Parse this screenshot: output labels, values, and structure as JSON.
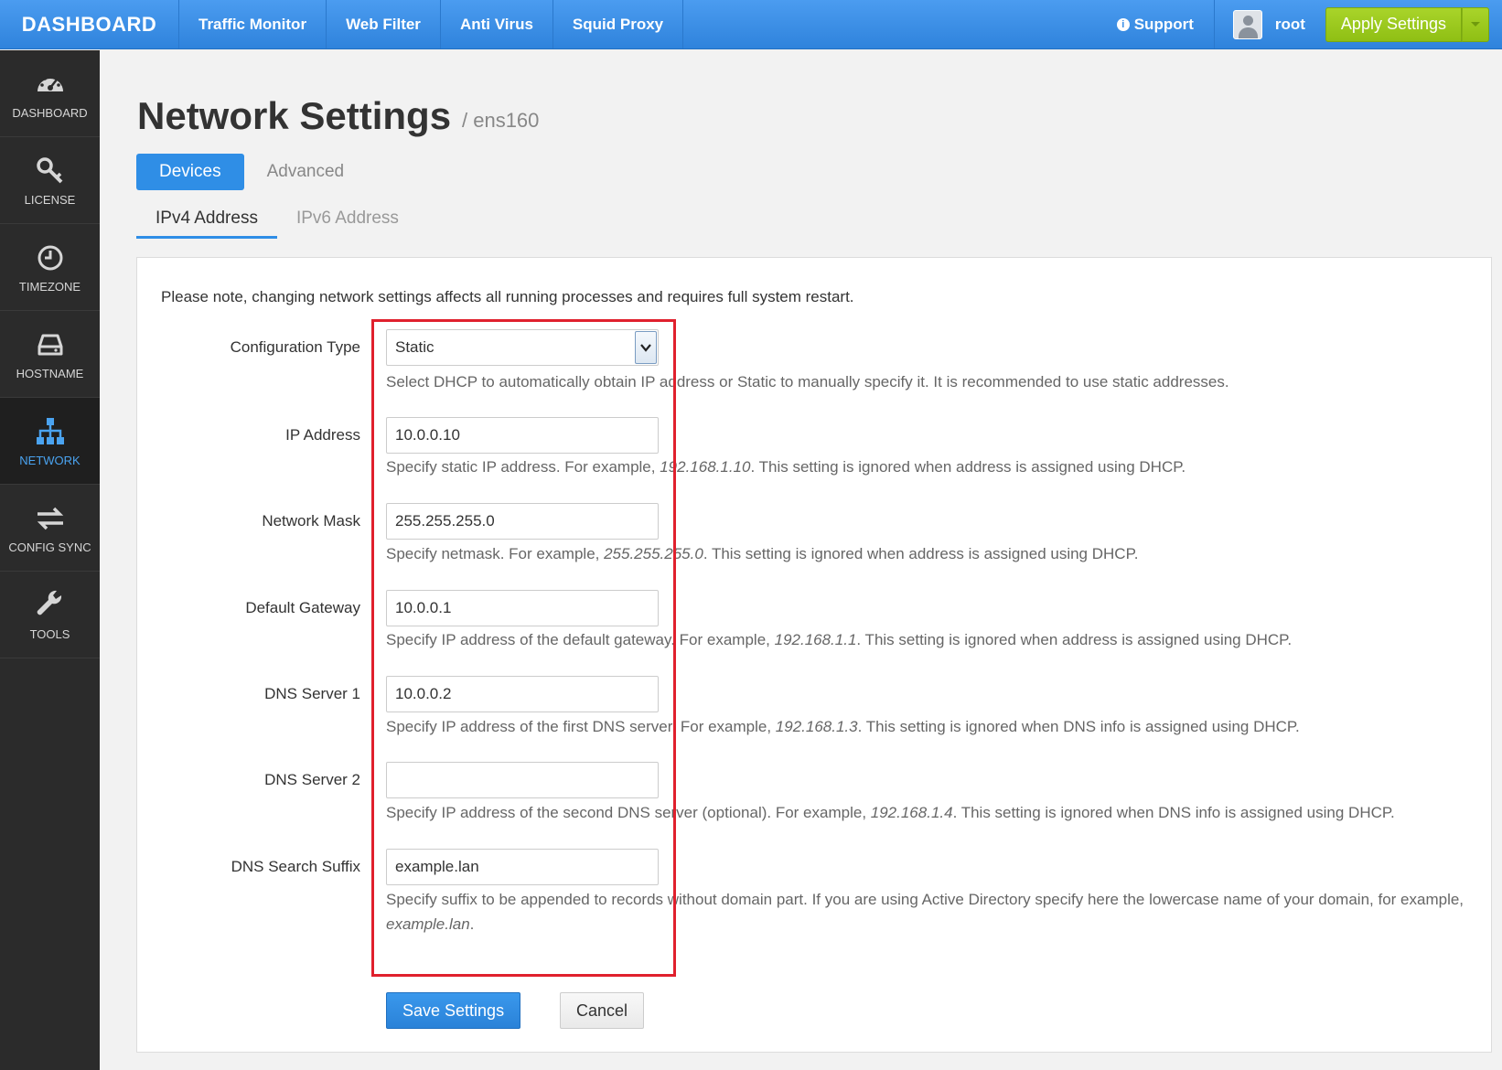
{
  "topbar": {
    "brand": "DASHBOARD",
    "nav": [
      "Traffic Monitor",
      "Web Filter",
      "Anti Virus",
      "Squid Proxy"
    ],
    "support": "Support",
    "user": "root",
    "apply": "Apply Settings"
  },
  "sidebar": {
    "items": [
      {
        "label": "DASHBOARD",
        "icon": "dashboard-icon"
      },
      {
        "label": "LICENSE",
        "icon": "key-icon"
      },
      {
        "label": "TIMEZONE",
        "icon": "clock-icon"
      },
      {
        "label": "HOSTNAME",
        "icon": "drive-icon"
      },
      {
        "label": "NETWORK",
        "icon": "network-icon"
      },
      {
        "label": "CONFIG SYNC",
        "icon": "sync-icon"
      },
      {
        "label": "TOOLS",
        "icon": "wrench-icon"
      }
    ],
    "active": "NETWORK"
  },
  "page": {
    "title": "Network Settings",
    "subtitle": "/ ens160",
    "tabs": [
      "Devices",
      "Advanced"
    ],
    "subtabs": [
      "IPv4 Address",
      "IPv6 Address"
    ],
    "note": "Please note, changing network settings affects all running processes and requires full system restart."
  },
  "form": {
    "config_type": {
      "label": "Configuration Type",
      "value": "Static",
      "help": "Select DHCP to automatically obtain IP address or Static to manually specify it. It is recommended to use static addresses."
    },
    "ip": {
      "label": "IP Address",
      "value": "10.0.0.10",
      "help_pre": "Specify static IP address. For example, ",
      "help_ex": "192.168.1.10",
      "help_post": ". This setting is ignored when address is assigned using DHCP."
    },
    "mask": {
      "label": "Network Mask",
      "value": "255.255.255.0",
      "help_pre": "Specify netmask. For example, ",
      "help_ex": "255.255.255.0",
      "help_post": ". This setting is ignored when address is assigned using DHCP."
    },
    "gateway": {
      "label": "Default Gateway",
      "value": "10.0.0.1",
      "help_pre": "Specify IP address of the default gateway. For example, ",
      "help_ex": "192.168.1.1",
      "help_post": ". This setting is ignored when address is assigned using DHCP."
    },
    "dns1": {
      "label": "DNS Server 1",
      "value": "10.0.0.2",
      "help_pre": "Specify IP address of the first DNS server. For example, ",
      "help_ex": "192.168.1.3",
      "help_post": ". This setting is ignored when DNS info is assigned using DHCP."
    },
    "dns2": {
      "label": "DNS Server 2",
      "value": "",
      "help_pre": "Specify IP address of the second DNS server (optional). For example, ",
      "help_ex": "192.168.1.4",
      "help_post": ". This setting is ignored when DNS info is assigned using DHCP."
    },
    "suffix": {
      "label": "DNS Search Suffix",
      "value": "example.lan",
      "help_pre": "Specify suffix to be appended to records without domain part. If you are using Active Directory specify here the lowercase name of your domain, for example, ",
      "help_ex": "example.lan",
      "help_post": "."
    }
  },
  "buttons": {
    "save": "Save Settings",
    "cancel": "Cancel"
  },
  "colors": {
    "accent": "#2f8ee6",
    "apply": "#9aca1e",
    "highlight": "#e0202d",
    "sidebar": "#2b2b2b"
  }
}
